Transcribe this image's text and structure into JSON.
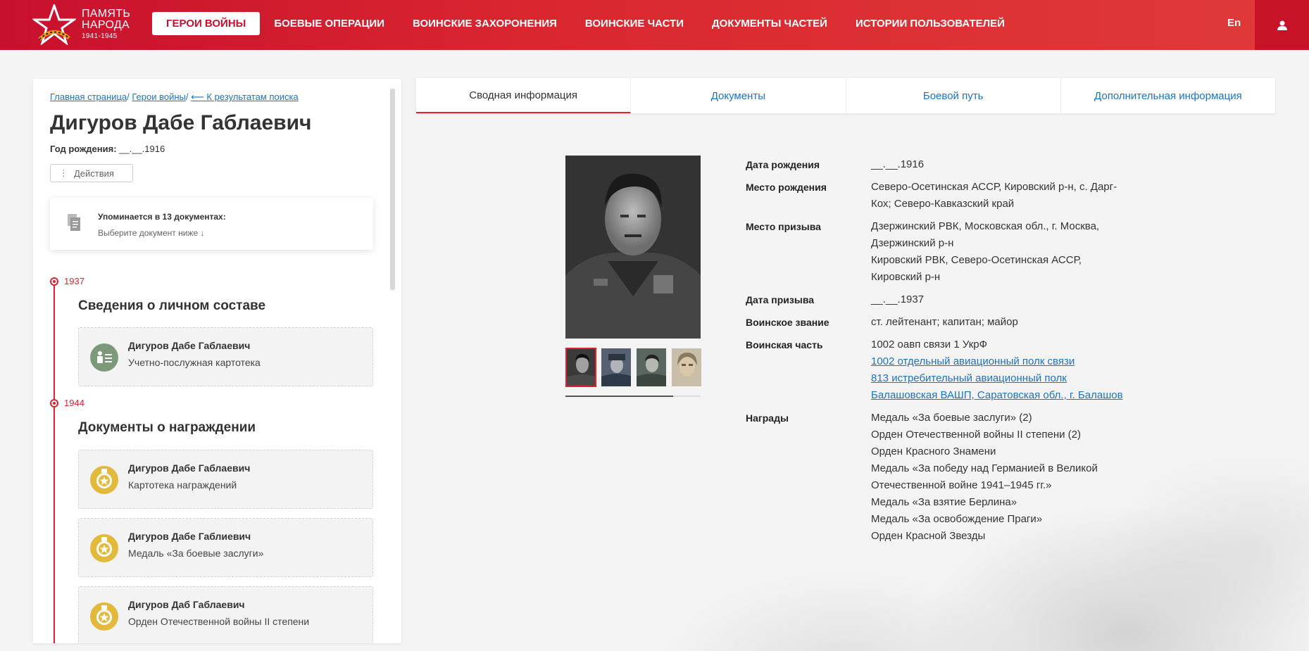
{
  "header": {
    "logo": {
      "line1": "ПАМЯТЬ",
      "line2": "НАРОДА",
      "years": "1941-1945"
    },
    "nav": [
      {
        "label": "Герои войны",
        "active": true
      },
      {
        "label": "Боевые операции",
        "active": false
      },
      {
        "label": "Воинские захоронения",
        "active": false
      },
      {
        "label": "Воинские части",
        "active": false
      },
      {
        "label": "Документы частей",
        "active": false
      },
      {
        "label": "Истории пользователей",
        "active": false
      }
    ],
    "lang": "En",
    "user_icon": "user-icon",
    "accent": "#d9262f"
  },
  "breadcrumb": {
    "home": "Главная страница",
    "sep1": "/",
    "heroes": "Герои войны",
    "sep2": "/",
    "back": "⟵ К результатам поиска"
  },
  "person": {
    "name": "Дигуров Дабе Габлаевич",
    "birth_label": "Год рождения:",
    "birth_value": "__.__.1916",
    "actions_label": "Действия"
  },
  "mentions": {
    "title": "Упоминается в 13 документах:",
    "subtitle": "Выберите документ ниже ↓"
  },
  "timeline": [
    {
      "year": "1937",
      "section": "Сведения о личном составе",
      "docs": [
        {
          "name": "Дигуров Дабе Габлаевич",
          "type": "Учетно-послужная картотека",
          "icon": "personnel-icon"
        }
      ]
    },
    {
      "year": "1944",
      "section": "Документы о награждении",
      "docs": [
        {
          "name": "Дигуров Дабе Габлаевич",
          "type": "Картотека награждений",
          "icon": "medal-icon"
        },
        {
          "name": "Дигуров Дабе Габлиевич",
          "type": "Медаль «За боевые заслуги»",
          "icon": "medal-icon"
        },
        {
          "name": "Дигуров Даб Габлаевич",
          "type": "Орден Отечественной войны II степени",
          "icon": "medal-icon"
        }
      ]
    }
  ],
  "tabs": [
    {
      "label": "Сводная информация",
      "active": true
    },
    {
      "label": "Документы",
      "active": false
    },
    {
      "label": "Боевой путь",
      "active": false
    },
    {
      "label": "Дополнительная информация",
      "active": false
    }
  ],
  "info": {
    "birth_date_label": "Дата рождения",
    "birth_date": "__.__.1916",
    "birth_place_label": "Место рождения",
    "birth_place": "Северо-Осетинская АССР, Кировский р-н, с. Дарг-Кох; Северо-Кавказский край",
    "draft_place_label": "Место призыва",
    "draft_place_1": "Дзержинский РВК, Московская обл., г. Москва, Дзержинский р-н",
    "draft_place_2": "Кировский РВК, Северо-Осетинская АССР, Кировский р-н",
    "draft_date_label": "Дата призыва",
    "draft_date": "__.__.1937",
    "rank_label": "Воинское звание",
    "rank": "ст. лейтенант; капитан; майор",
    "unit_label": "Воинская часть",
    "unit_text": "1002 оавп связи 1 УкрФ",
    "unit_links": [
      "1002 отдельный авиационный полк связи",
      "813 истребительный авиационный полк",
      "Балашовская ВАШП, Саратовская обл., г. Балашов"
    ],
    "awards_label": "Награды",
    "awards": [
      "Медаль «За боевые заслуги» (2)",
      "Орден Отечественной войны II степени (2)",
      "Орден Красного Знамени",
      "Медаль «За победу над Германией в Великой Отечественной войне 1941–1945 гг.»",
      "Медаль «За взятие Берлина»",
      "Медаль «За освобождение Праги»",
      "Орден Красной Звезды"
    ]
  },
  "photos": {
    "count": 4,
    "active_index": 0
  }
}
